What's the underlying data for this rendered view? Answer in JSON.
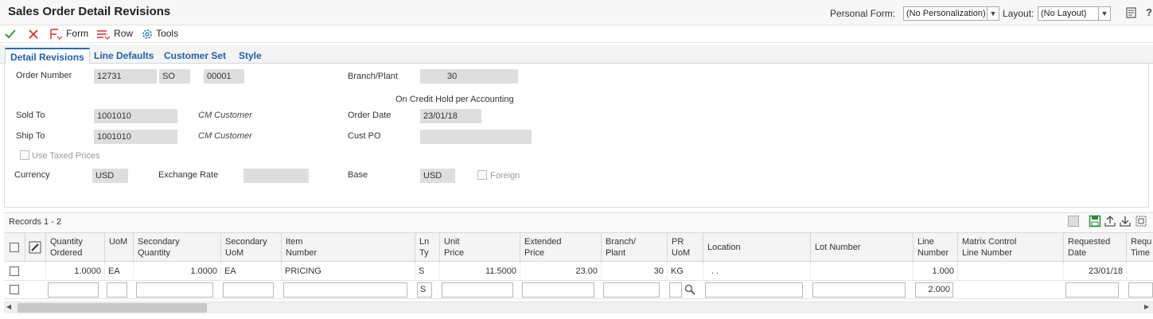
{
  "header": {
    "title": "Sales Order Detail Revisions",
    "personal_form_label": "Personal Form:",
    "personal_form_value": "(No Personalization)",
    "layout_label": "Layout:",
    "layout_value": "(No Layout)",
    "help_glyph": "?"
  },
  "toolbar": {
    "form_label": "Form",
    "row_label": "Row",
    "tools_label": "Tools"
  },
  "tabs": [
    {
      "label": "Detail Revisions",
      "active": true
    },
    {
      "label": "Line Defaults"
    },
    {
      "label": "Customer Set"
    },
    {
      "label": "Style"
    }
  ],
  "form": {
    "order_number_label": "Order Number",
    "order_number": "12731",
    "order_type": "SO",
    "order_company": "00001",
    "branch_plant_label": "Branch/Plant",
    "branch_plant": "30",
    "credit_hold_text": "On Credit Hold per Accounting",
    "sold_to_label": "Sold To",
    "sold_to": "1001010",
    "sold_to_name": "CM Customer",
    "order_date_label": "Order Date",
    "order_date": "23/01/18",
    "ship_to_label": "Ship To",
    "ship_to": "1001010",
    "ship_to_name": "CM Customer",
    "cust_po_label": "Cust PO",
    "cust_po": "",
    "use_taxed_prices_label": "Use Taxed Prices",
    "currency_label": "Currency",
    "currency": "USD",
    "exchange_rate_label": "Exchange Rate",
    "exchange_rate": "",
    "base_label": "Base",
    "base": "USD",
    "foreign_label": "Foreign"
  },
  "grid": {
    "records_label": "Records 1 - 2",
    "columns": [
      {
        "line1": "Quantity",
        "line2": "Ordered"
      },
      {
        "line1": "UoM",
        "line2": ""
      },
      {
        "line1": "Secondary",
        "line2": "Quantity"
      },
      {
        "line1": "Secondary",
        "line2": "UoM"
      },
      {
        "line1": "Item",
        "line2": "Number"
      },
      {
        "line1": "Ln",
        "line2": "Ty"
      },
      {
        "line1": "Unit",
        "line2": "Price"
      },
      {
        "line1": "Extended",
        "line2": "Price"
      },
      {
        "line1": "Branch/",
        "line2": "Plant"
      },
      {
        "line1": "PR",
        "line2": "UoM"
      },
      {
        "line1": "Location",
        "line2": ""
      },
      {
        "line1": "Lot Number",
        "line2": ""
      },
      {
        "line1": "Line",
        "line2": "Number"
      },
      {
        "line1": "Matrix Control",
        "line2": "Line Number"
      },
      {
        "line1": "Requested",
        "line2": "Date"
      },
      {
        "line1": "Requ",
        "line2": "Time"
      }
    ],
    "row1": {
      "quantity_ordered": "1.0000",
      "uom": "EA",
      "secondary_quantity": "1.0000",
      "secondary_uom": "EA",
      "item_number": "PRICING",
      "line_type": "S",
      "unit_price": "11.5000",
      "extended_price": "23.00",
      "branch_plant": "30",
      "pr_uom": "KG",
      "location": ".   .",
      "lot_number": "",
      "line_number": "1.000",
      "matrix_line": "",
      "requested_date": "23/01/18"
    },
    "row2": {
      "line_type": "S",
      "line_number": "2.000"
    }
  },
  "colors": {
    "accent": "#1f5fa8",
    "confirm": "#2e9a3a",
    "cancel": "#d8302a",
    "save_icon": "#2e8a3a"
  }
}
